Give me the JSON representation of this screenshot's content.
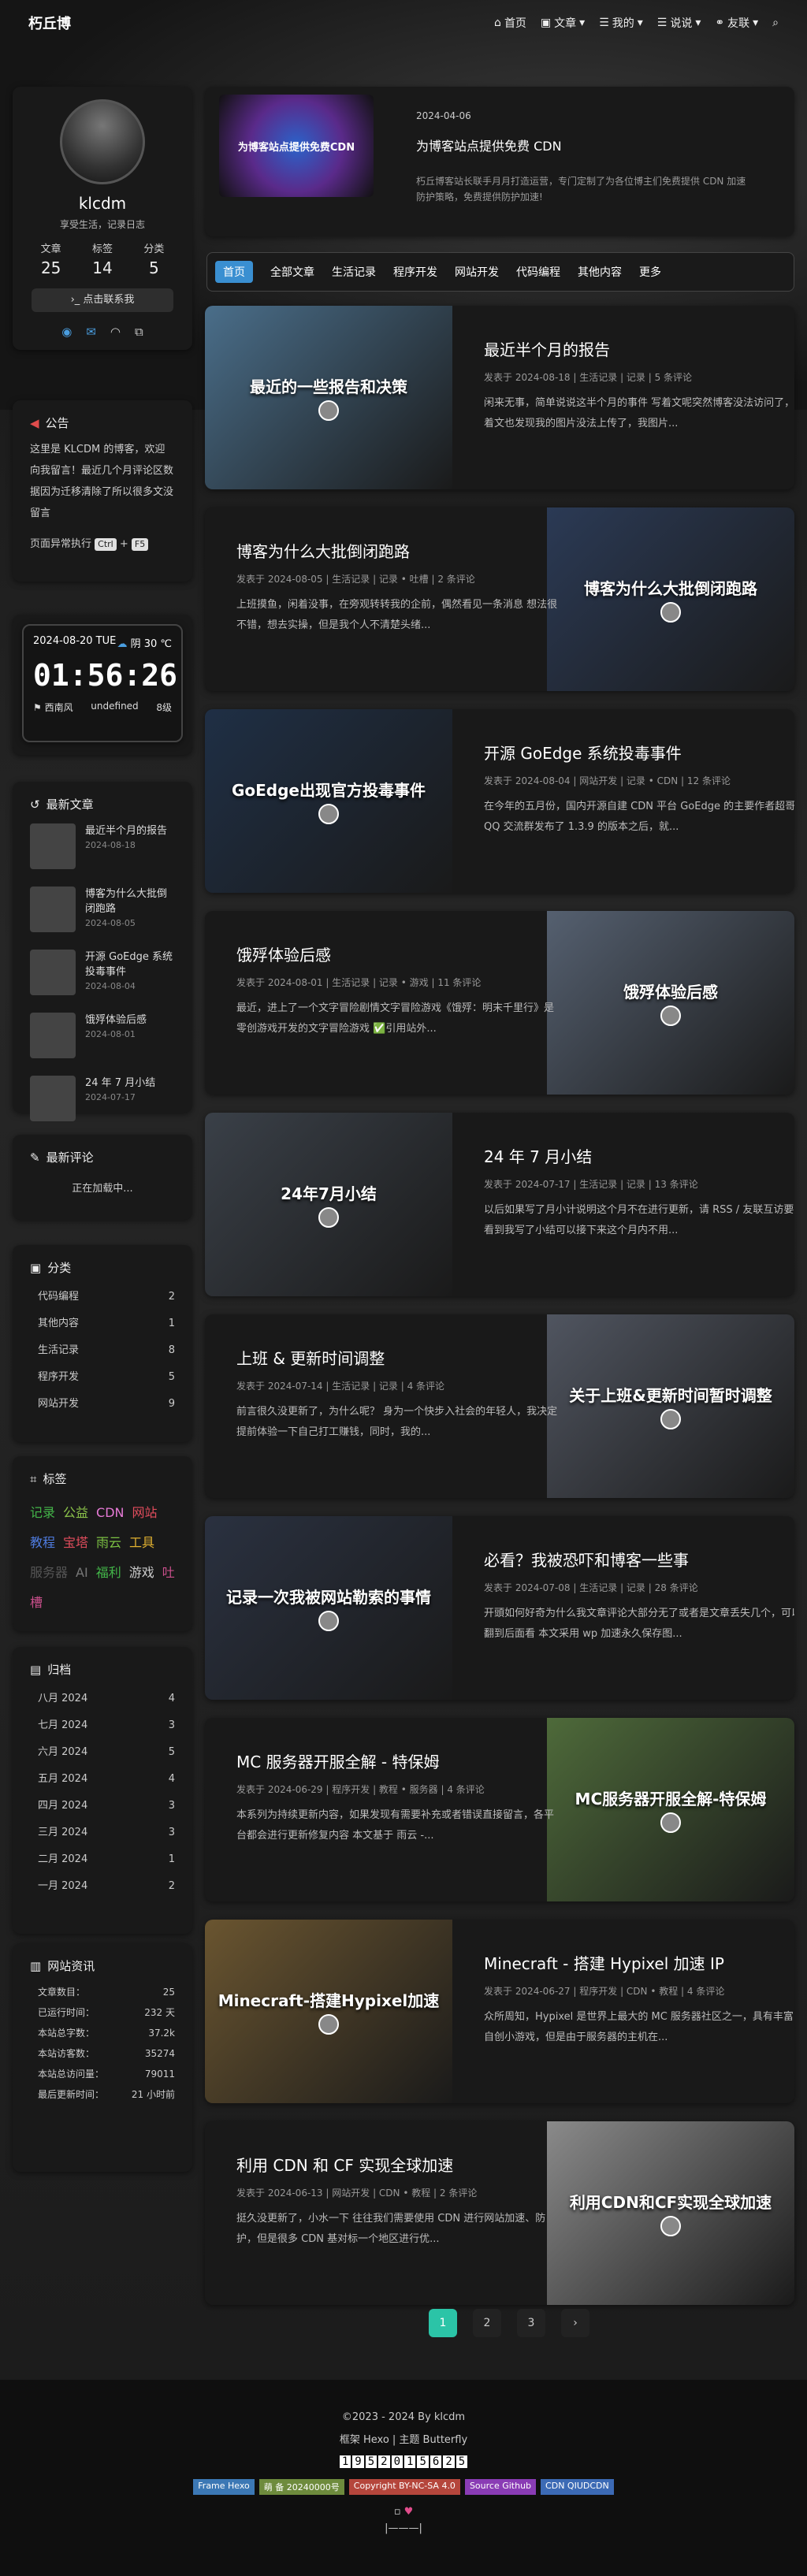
{
  "nav": {
    "brand": "朽丘博",
    "home": "首页",
    "articles": "文章",
    "mine": "我的",
    "talks": "说说",
    "friends": "友联"
  },
  "profile": {
    "name": "klcdm",
    "bio": "享受生活，记录日志",
    "posts_label": "文章",
    "posts": "25",
    "tags_label": "标签",
    "tags": "14",
    "cats_label": "分类",
    "cats": "5",
    "button": "点击联系我"
  },
  "notice": {
    "title": "公告",
    "text": "这里是 KLCDM 的博客，欢迎向我留言！最近几个月评论区数据因为迁移清除了所以很多文没留言",
    "exec": "页面异常执行",
    "k1": "Ctrl",
    "plus": "+",
    "k2": "F5"
  },
  "clock": {
    "date": "2024-08-20 TUE",
    "weather": "阴 30 ℃",
    "time": "01:56:26",
    "loc": "西南风",
    "undef": "undefined",
    "lvl": "8级"
  },
  "recent": {
    "title": "最新文章",
    "items": [
      {
        "t": "最近半个月的报告",
        "d": "2024-08-18"
      },
      {
        "t": "博客为什么大批倒闭跑路",
        "d": "2024-08-05"
      },
      {
        "t": "开源 GoEdge 系统投毒事件",
        "d": "2024-08-04"
      },
      {
        "t": "饿殍体验后感",
        "d": "2024-08-01"
      },
      {
        "t": "24 年 7 月小结",
        "d": "2024-07-17"
      }
    ]
  },
  "comments": {
    "title": "最新评论",
    "loading": "正在加载中..."
  },
  "categories": {
    "title": "分类",
    "items": [
      {
        "n": "代码编程",
        "c": "2"
      },
      {
        "n": "其他内容",
        "c": "1"
      },
      {
        "n": "生活记录",
        "c": "8"
      },
      {
        "n": "程序开发",
        "c": "5"
      },
      {
        "n": "网站开发",
        "c": "9"
      }
    ]
  },
  "tagcloud": {
    "title": "标签",
    "items": [
      {
        "t": "记录",
        "c": "#43b649"
      },
      {
        "t": "公益",
        "c": "#8bc34a"
      },
      {
        "t": "CDN",
        "c": "#e67ad6"
      },
      {
        "t": "网站",
        "c": "#e04c5c"
      },
      {
        "t": "教程",
        "c": "#4f7ce0"
      },
      {
        "t": "宝塔",
        "c": "#e04c5c"
      },
      {
        "t": "雨云",
        "c": "#7bc043"
      },
      {
        "t": "工具",
        "c": "#e0b030"
      },
      {
        "t": "服务器",
        "c": "#555"
      },
      {
        "t": "AI",
        "c": "#777"
      },
      {
        "t": "福利",
        "c": "#43b649"
      },
      {
        "t": "游戏",
        "c": "#ccc"
      },
      {
        "t": "吐槽",
        "c": "#c94f8b"
      }
    ]
  },
  "archive": {
    "title": "归档",
    "items": [
      {
        "n": "八月 2024",
        "c": "4"
      },
      {
        "n": "七月 2024",
        "c": "3"
      },
      {
        "n": "六月 2024",
        "c": "5"
      },
      {
        "n": "五月 2024",
        "c": "4"
      },
      {
        "n": "四月 2024",
        "c": "3"
      },
      {
        "n": "三月 2024",
        "c": "3"
      },
      {
        "n": "二月 2024",
        "c": "1"
      },
      {
        "n": "一月 2024",
        "c": "2"
      }
    ]
  },
  "siteinfo": {
    "title": "网站资讯",
    "items": [
      {
        "n": "文章数目：",
        "c": "25"
      },
      {
        "n": "已运行时间：",
        "c": "232 天"
      },
      {
        "n": "本站总字数：",
        "c": "37.2k"
      },
      {
        "n": "本站访客数：",
        "c": "35274"
      },
      {
        "n": "本站总访问量：",
        "c": "79011"
      },
      {
        "n": "最后更新时间：",
        "c": "21 小时前"
      }
    ]
  },
  "featured": {
    "date": "2024-04-06",
    "title": "为博客站点提供免费 CDN",
    "desc": "朽丘博客站长联手月月打造运营，专门定制了为各位博主们免费提供 CDN 加速防护策略，免费提供防护加速!",
    "img": "为博客站点提供免费CDN"
  },
  "tabs": [
    "首页",
    "全部文章",
    "生活记录",
    "程序开发",
    "网站开发",
    "代码编程",
    "其他内容",
    "更多"
  ],
  "posts": [
    {
      "title": "最近半个月的报告",
      "date": "发表于 2024-08-18",
      "cat": "生活记录",
      "tag": "记录",
      "cm": "5 条评论",
      "desc": "闲来无事，简单说说这半个月的事件 写着文呢突然博客没法访问了，写着文也发现我的图片没法上传了，我图片...",
      "img": "最近的一些报告和决策",
      "c": "#4a6e8a"
    },
    {
      "title": "博客为什么大批倒闭跑路",
      "date": "发表于 2024-08-05",
      "cat": "生活记录",
      "tag": "记录 • 吐槽",
      "cm": "2 条评论",
      "desc": "上班摸鱼，闲着没事，在旁观转转我的企前，偶然看见一条消息 想法很不错，想去实操，但是我个人不清楚头绪...",
      "img": "博客为什么大批倒闭跑路",
      "c": "#2b3a55"
    },
    {
      "title": "开源 GoEdge 系统投毒事件",
      "date": "发表于 2024-08-04",
      "cat": "网站开发",
      "tag": "记录 • CDN",
      "cm": "12 条评论",
      "desc": "在今年的五月份，国内开源自建 CDN 平台 GoEdge 的主要作者超哥在 QQ 交流群发布了 1.3.9 的版本之后，就...",
      "img": "GoEdge出现官方投毒事件",
      "c": "#1f2f45"
    },
    {
      "title": "饿殍体验后感",
      "date": "发表于 2024-08-01",
      "cat": "生活记录",
      "tag": "记录 • 游戏",
      "cm": "11 条评论",
      "desc": "最近，进上了一个文字冒险剧情文字冒险游戏《饿殍：明末千里行》是零创游戏开发的文字冒险游戏 ✅引用站外...",
      "img": "饿殍体验后感",
      "c": "#556070"
    },
    {
      "title": "24 年 7 月小结",
      "date": "发表于 2024-07-17",
      "cat": "生活记录",
      "tag": "记录",
      "cm": "13 条评论",
      "desc": "以后如果写了月小计说明这个月不在进行更新，请 RSS / 友联互访要是看到我写了小结可以接下来这个月内不用...",
      "img": "24年7月小结",
      "c": "#3a4048"
    },
    {
      "title": "上班 & 更新时间调整",
      "date": "发表于 2024-07-14",
      "cat": "生活记录",
      "tag": "记录",
      "cm": "4 条评论",
      "desc": "前言很久没更新了，为什么呢？ 身为一个快步入社会的年轻人，我决定提前体验一下自己打工赚钱，同时，我的...",
      "img": "关于上班&更新时间暂时调整",
      "c": "#505560"
    },
    {
      "title": "必看？我被恐吓和博客一些事",
      "date": "发表于 2024-07-08",
      "cat": "生活记录",
      "tag": "记录",
      "cm": "28 条评论",
      "desc": "开頭如何好奇为什么我文章评论大部分无了或者是文章丢失几个，可以翻到后面看 本文采用 wp 加速永久保存图...",
      "img": "记录一次我被网站勒索的事情",
      "c": "#2a3140"
    },
    {
      "title": "MC 服务器开服全解 - 特保姆",
      "date": "发表于 2024-06-29",
      "cat": "程序开发",
      "tag": "教程 • 服务器",
      "cm": "4 条评论",
      "desc": "本系列为持续更新内容，如果发现有需要补充或者错误直接留言，各平台都会进行更新修复内容 本文基于 雨云 -...",
      "img": "MC服务器开服全解-特保姆",
      "c": "#4e6a3a"
    },
    {
      "title": "Minecraft - 搭建 Hypixel 加速 IP",
      "date": "发表于 2024-06-27",
      "cat": "程序开发",
      "tag": "CDN • 教程",
      "cm": "4 条评论",
      "desc": "众所周知，Hypixel 是世界上最大的 MC 服务器社区之一，具有丰富的自创小游戏，但是由于服务器的主机在...",
      "img": "Minecraft-搭建Hypixel加速",
      "c": "#6a5530"
    },
    {
      "title": "利用 CDN 和 CF 实现全球加速",
      "date": "发表于 2024-06-13",
      "cat": "网站开发",
      "tag": "CDN • 教程",
      "cm": "2 条评论",
      "desc": "挺久没更新了，小水一下 往往我们需要使用 CDN 进行网站加速、防护，但是很多 CDN 基对标一个地区进行优...",
      "img": "利用CDN和CF实现全球加速",
      "c": "#8a8a8a"
    }
  ],
  "pager": [
    "1",
    "2",
    "3",
    "›"
  ],
  "footer": {
    "copy": "©2023 - 2024 By klcdm",
    "fw": "框架 Hexo | 主题 Butterfly",
    "counter": [
      "1",
      "9",
      "5",
      "2",
      "0",
      "1",
      "5",
      "6",
      "2",
      "5"
    ],
    "b1": "Frame Hexo",
    "b2": "萌 备 20240000号",
    "b3": "Copyright BY-NC-SA 4.0",
    "b4": "Source Github",
    "b5": "CDN QIUDCDN",
    "sep": "|———|"
  }
}
